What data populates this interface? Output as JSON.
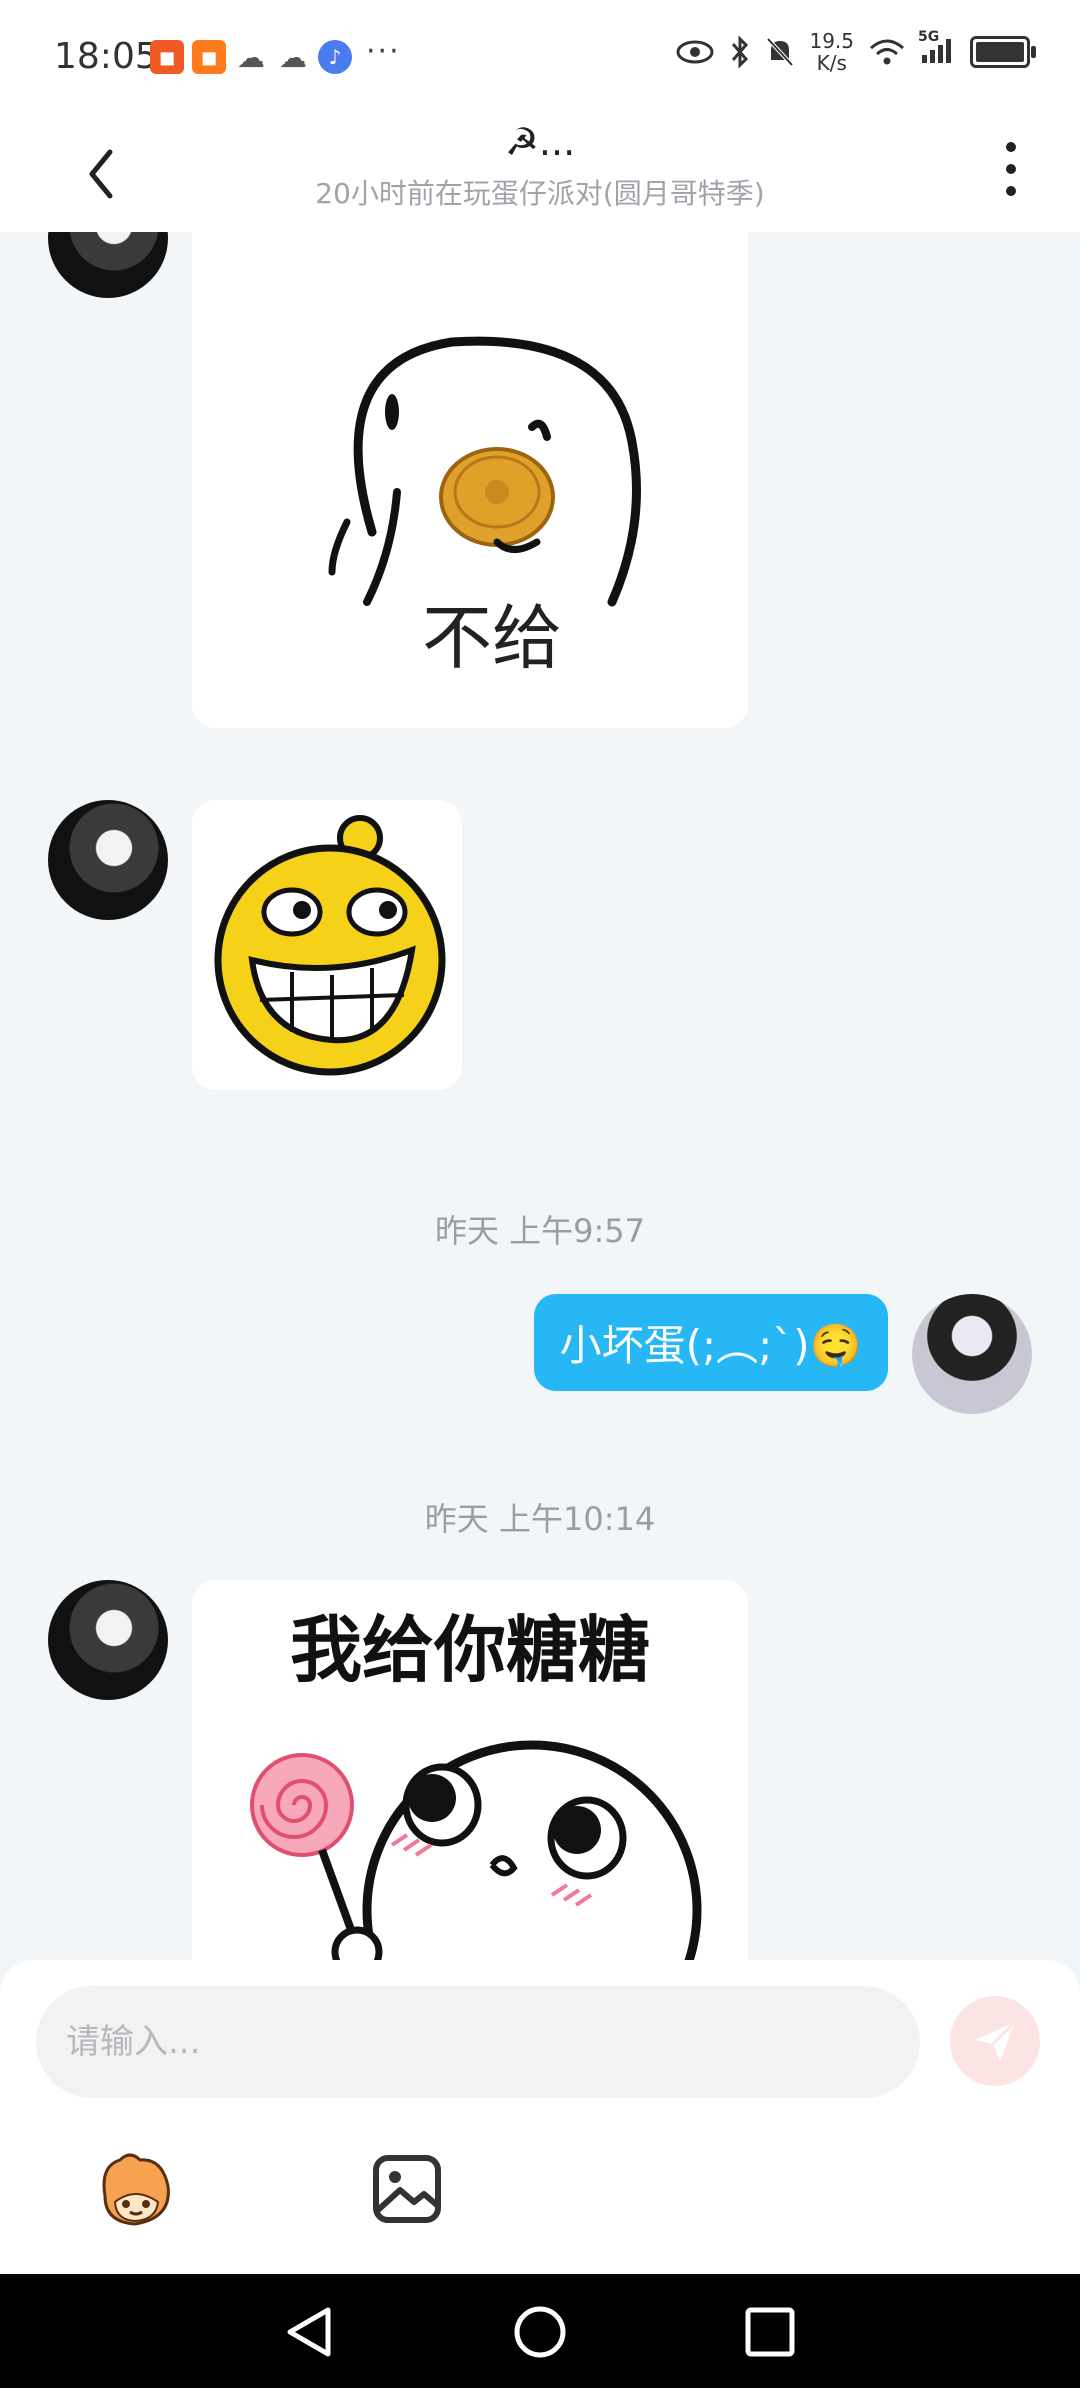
{
  "status_bar": {
    "time": "18:05",
    "app_icons": [
      "kuaishou-icon",
      "kuaishou-icon",
      "wechat-icon",
      "wechat-icon",
      "music-icon"
    ],
    "more": "···",
    "speed_value": "19.5",
    "speed_unit": "K/s",
    "network": "5G"
  },
  "header": {
    "title": "☭...",
    "subtitle": "20小时前在玩蛋仔派对(圆月哥特季)"
  },
  "messages": [
    {
      "type": "sticker",
      "side": "left",
      "sticker_text": "不给"
    },
    {
      "type": "sticker",
      "side": "left",
      "sticker_text": ""
    },
    {
      "type": "timestamp",
      "text": "昨天 上午9:57"
    },
    {
      "type": "text",
      "side": "right",
      "text": "小坏蛋(;︵;`)🤤"
    },
    {
      "type": "timestamp",
      "text": "昨天 上午10:14"
    },
    {
      "type": "sticker",
      "side": "left",
      "sticker_text": "我给你糖糖"
    }
  ],
  "input": {
    "placeholder": "请输入..."
  },
  "colors": {
    "accent_blue": "#27b7f5",
    "send_pink": "#fde4e4",
    "background": "#f3f6f9"
  }
}
